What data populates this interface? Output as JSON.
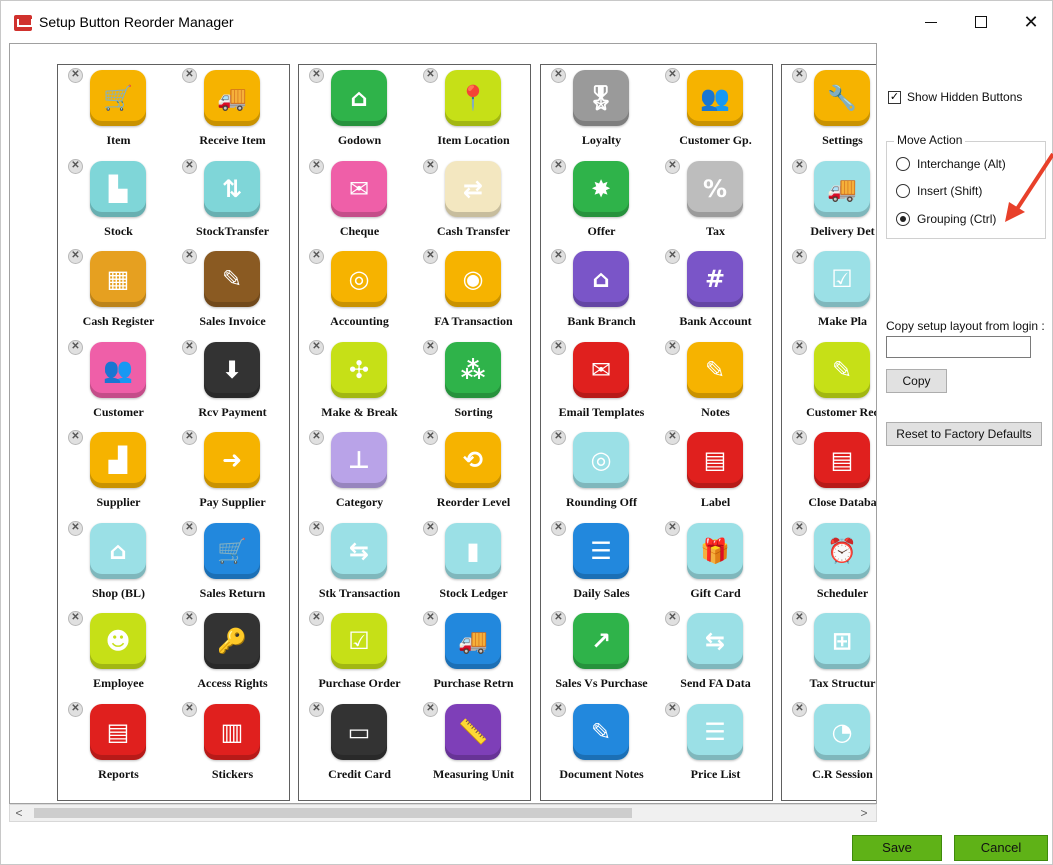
{
  "window": {
    "title": "Setup Button Reorder Manager"
  },
  "groups": [
    [
      {
        "label": "Item",
        "icon": "cart-icon",
        "color": "#f6b300",
        "glyph": "🛒"
      },
      {
        "label": "Receive Item",
        "icon": "truck-icon",
        "color": "#f6b300",
        "glyph": "🚚"
      },
      {
        "label": "Stock",
        "icon": "trolley-icon",
        "color": "#7fd6d8",
        "glyph": "▙"
      },
      {
        "label": "StockTransfer",
        "icon": "stock-transfer-icon",
        "color": "#7fd6d8",
        "glyph": "⇅"
      },
      {
        "label": "Cash Register",
        "icon": "cash-register-icon",
        "color": "#e6a020",
        "glyph": "▦"
      },
      {
        "label": "Sales Invoice",
        "icon": "invoice-icon",
        "color": "#8a5a22",
        "glyph": "✎"
      },
      {
        "label": "Customer",
        "icon": "customer-icon",
        "color": "#ef5fa8",
        "glyph": "👥"
      },
      {
        "label": "Rcv Payment",
        "icon": "receive-payment-icon",
        "color": "#333333",
        "glyph": "⬇"
      },
      {
        "label": "Supplier",
        "icon": "factory-icon",
        "color": "#f6b300",
        "glyph": "▟"
      },
      {
        "label": "Pay Supplier",
        "icon": "factory-arrow-icon",
        "color": "#f6b300",
        "glyph": "➜"
      },
      {
        "label": "Shop (BL)",
        "icon": "shop-icon",
        "color": "#9be0e6",
        "glyph": "⌂"
      },
      {
        "label": "Sales Return",
        "icon": "return-cart-icon",
        "color": "#2288dd",
        "glyph": "🛒"
      },
      {
        "label": "Employee",
        "icon": "employee-icon",
        "color": "#c6e017",
        "glyph": "☻"
      },
      {
        "label": "Access Rights",
        "icon": "key-lock-icon",
        "color": "#333333",
        "glyph": "🔑"
      },
      {
        "label": "Reports",
        "icon": "reports-icon",
        "color": "#e0201e",
        "glyph": "▤"
      },
      {
        "label": "Stickers",
        "icon": "barcode-icon",
        "color": "#e0201e",
        "glyph": "▥"
      }
    ],
    [
      {
        "label": "Godown",
        "icon": "godown-icon",
        "color": "#2fb34a",
        "glyph": "⌂"
      },
      {
        "label": "Item Location",
        "icon": "location-pin-icon",
        "color": "#c6e017",
        "glyph": "📍"
      },
      {
        "label": "Cheque",
        "icon": "cheque-icon",
        "color": "#ef5fa8",
        "glyph": "✉"
      },
      {
        "label": "Cash Transfer",
        "icon": "cash-transfer-icon",
        "color": "#f3e7c0",
        "glyph": "⇄"
      },
      {
        "label": "Accounting",
        "icon": "coins-icon",
        "color": "#f6b300",
        "glyph": "◎"
      },
      {
        "label": "FA Transaction",
        "icon": "coins-arrow-icon",
        "color": "#f6b300",
        "glyph": "◉"
      },
      {
        "label": "Make & Break",
        "icon": "make-break-icon",
        "color": "#c6e017",
        "glyph": "✣"
      },
      {
        "label": "Sorting",
        "icon": "sorting-icon",
        "color": "#2fb34a",
        "glyph": "⁂"
      },
      {
        "label": "Category",
        "icon": "category-tree-icon",
        "color": "#b9a3e8",
        "glyph": "⊥"
      },
      {
        "label": "Reorder Level",
        "icon": "reorder-icon",
        "color": "#f6b300",
        "glyph": "⟲"
      },
      {
        "label": "Stk Transaction",
        "icon": "stock-transaction-icon",
        "color": "#9be0e6",
        "glyph": "⇆"
      },
      {
        "label": "Stock Ledger",
        "icon": "ledger-chart-icon",
        "color": "#9be0e6",
        "glyph": "▮"
      },
      {
        "label": "Purchase Order",
        "icon": "purchase-order-icon",
        "color": "#c6e017",
        "glyph": "☑"
      },
      {
        "label": "Purchase Retrn",
        "icon": "purchase-return-icon",
        "color": "#2288dd",
        "glyph": "🚚"
      },
      {
        "label": "Credit Card",
        "icon": "credit-card-icon",
        "color": "#333333",
        "glyph": "▭"
      },
      {
        "label": "Measuring Unit",
        "icon": "ruler-icon",
        "color": "#7e3fb8",
        "glyph": "📏"
      }
    ],
    [
      {
        "label": "Loyalty",
        "icon": "loyalty-ribbon-icon",
        "color": "#9a9a9a",
        "glyph": "🎖"
      },
      {
        "label": "Customer Gp.",
        "icon": "customer-group-icon",
        "color": "#f6b300",
        "glyph": "👥"
      },
      {
        "label": "Offer",
        "icon": "offer-icon",
        "color": "#2fb34a",
        "glyph": "✸"
      },
      {
        "label": "Tax",
        "icon": "percent-icon",
        "color": "#bdbdbd",
        "glyph": "%"
      },
      {
        "label": "Bank Branch",
        "icon": "bank-icon",
        "color": "#7a55c8",
        "glyph": "⌂"
      },
      {
        "label": "Bank Account",
        "icon": "bank-account-icon",
        "color": "#7a55c8",
        "glyph": "#"
      },
      {
        "label": "Email Templates",
        "icon": "email-icon",
        "color": "#e0201e",
        "glyph": "✉"
      },
      {
        "label": "Notes",
        "icon": "notes-icon",
        "color": "#f6b300",
        "glyph": "✎"
      },
      {
        "label": "Rounding Off",
        "icon": "target-icon",
        "color": "#9be0e6",
        "glyph": "◎"
      },
      {
        "label": "Label",
        "icon": "label-icon",
        "color": "#e0201e",
        "glyph": "▤"
      },
      {
        "label": "Daily Sales",
        "icon": "daily-sales-icon",
        "color": "#2288dd",
        "glyph": "☰"
      },
      {
        "label": "Gift Card",
        "icon": "gift-card-icon",
        "color": "#9be0e6",
        "glyph": "🎁"
      },
      {
        "label": "Sales Vs Purchase",
        "icon": "trend-chart-icon",
        "color": "#2fb34a",
        "glyph": "↗"
      },
      {
        "label": "Send FA Data",
        "icon": "send-data-icon",
        "color": "#9be0e6",
        "glyph": "⇆"
      },
      {
        "label": "Document Notes",
        "icon": "document-notes-icon",
        "color": "#2288dd",
        "glyph": "✎"
      },
      {
        "label": "Price List",
        "icon": "price-list-icon",
        "color": "#9be0e6",
        "glyph": "☰"
      }
    ],
    [
      {
        "label": "Settings",
        "icon": "settings-tools-icon",
        "color": "#f6b300",
        "glyph": "🔧"
      },
      {
        "label": "Delivery Det",
        "icon": "delivery-icon",
        "color": "#9be0e6",
        "glyph": "🚚"
      },
      {
        "label": "Make Pla",
        "icon": "make-plan-icon",
        "color": "#9be0e6",
        "glyph": "☑"
      },
      {
        "label": "Customer Rec",
        "icon": "customer-receipt-icon",
        "color": "#c6e017",
        "glyph": "✎"
      },
      {
        "label": "Close Databa",
        "icon": "close-database-icon",
        "color": "#e0201e",
        "glyph": "▤"
      },
      {
        "label": "Scheduler",
        "icon": "alarm-clock-icon",
        "color": "#9be0e6",
        "glyph": "⏰"
      },
      {
        "label": "Tax Structur",
        "icon": "tax-structure-icon",
        "color": "#9be0e6",
        "glyph": "⊞"
      },
      {
        "label": "C.R Session",
        "icon": "cr-session-icon",
        "color": "#9be0e6",
        "glyph": "◔"
      }
    ]
  ],
  "sidebar": {
    "show_hidden_label": "Show Hidden Buttons",
    "show_hidden_checked": "✓",
    "move_action_legend": "Move Action",
    "move_options": [
      {
        "label": "Interchange (Alt)",
        "selected": false
      },
      {
        "label": "Insert (Shift)",
        "selected": false
      },
      {
        "label": "Grouping (Ctrl)",
        "selected": true
      }
    ],
    "copy_label": "Copy setup layout from login :",
    "copy_value": "",
    "copy_button": "Copy",
    "reset_button": "Reset to Factory Defaults"
  },
  "footer": {
    "save_label": "Save",
    "cancel_label": "Cancel"
  },
  "close_glyph": "✕",
  "scroll_left": "<",
  "scroll_right": ">"
}
